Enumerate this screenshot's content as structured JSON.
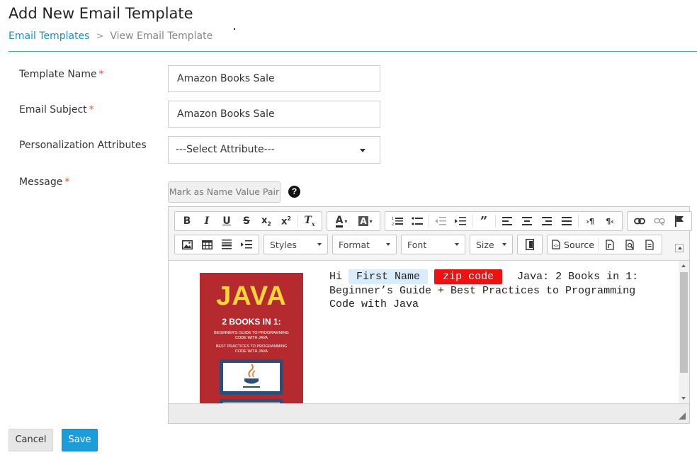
{
  "page": {
    "title": "Add New Email Template"
  },
  "breadcrumb": {
    "items": [
      "Email Templates",
      "View Email Template"
    ],
    "separator": ">"
  },
  "form": {
    "template_name": {
      "label": "Template Name",
      "value": "Amazon Books Sale",
      "required_mark": "*"
    },
    "email_subject": {
      "label": "Email Subject",
      "value": "Amazon Books Sale",
      "required_mark": "*"
    },
    "personalization": {
      "label": "Personalization Attributes",
      "selected": "---Select Attribute---"
    },
    "message": {
      "label": "Message",
      "required_mark": "*",
      "mark_button": "Mark as Name Value Pair",
      "help_icon": "?"
    }
  },
  "editor": {
    "toolbar_row1": [
      "bold",
      "italic",
      "underline",
      "strikethrough",
      "subscript",
      "superscript",
      "remove-format",
      "text-color",
      "background-color",
      "numbered-list",
      "bulleted-list",
      "outdent",
      "indent",
      "blockquote",
      "align-left",
      "align-center",
      "align-right",
      "justify",
      "text-direction-ltr",
      "text-direction-rtl",
      "link",
      "unlink",
      "anchor"
    ],
    "toolbar_row2": [
      "image",
      "table",
      "horizontal-line",
      "indent-block"
    ],
    "combos": [
      "Styles",
      "Format",
      "Font",
      "Size"
    ],
    "source_label": "Source",
    "content": {
      "greeting": "Hi",
      "first_name_tag": "First Name",
      "zip_code_tag": "zip code",
      "line1_rest": "Java: 2 Books in 1:",
      "line2": "Beginner’s Guide + Best Practices to Programming",
      "line3": "Code with Java"
    },
    "book_cover": {
      "title": "JAVA",
      "subtitle": "2 BOOKS IN 1:",
      "line1": "BEGINNER'S GUIDE TO PROGRAMMING",
      "line2": "CODE WITH JAVA",
      "line3": "BEST PRACTICES TO PROGRAMMING",
      "line4": "CODE WITH JAVA"
    }
  },
  "buttons": {
    "cancel": "Cancel",
    "save": "Save"
  },
  "colors": {
    "accent": "#1a9dd9",
    "required": "#d9534f",
    "zip_tag_bg": "#ee1111",
    "name_tag_bg": "#d9ecfb",
    "book_red": "#b52a2e",
    "book_yellow": "#f8d53a"
  }
}
